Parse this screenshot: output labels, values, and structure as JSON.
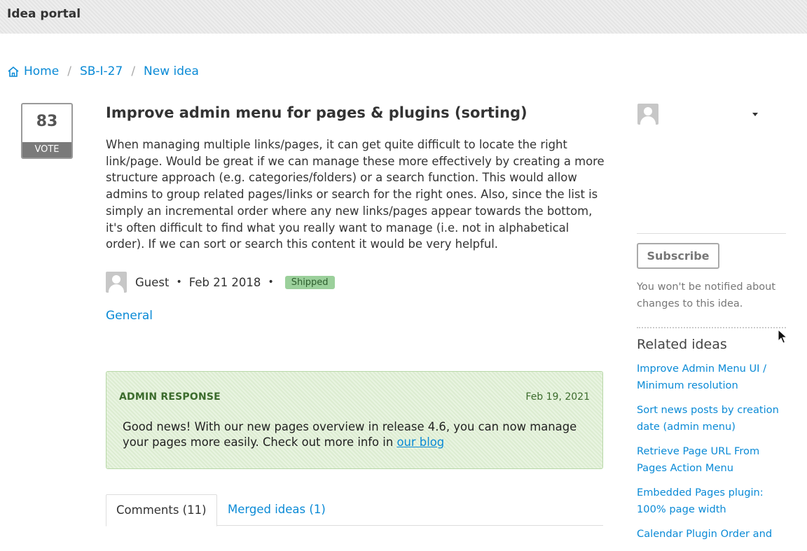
{
  "header": {
    "title": "Idea portal"
  },
  "breadcrumb": {
    "home": "Home",
    "id": "SB-I-27",
    "current": "New idea"
  },
  "idea": {
    "votes": "83",
    "vote_label": "VOTE",
    "title": "Improve admin menu for pages & plugins (sorting)",
    "description": "When managing multiple links/pages, it can get quite difficult to locate the right link/page. Would be great if we can manage these more effectively by creating a more structure approach (e.g. categories/folders) or a search function. This would allow admins to group related pages/links or search for the right ones. Also, since the list is simply an incremental order where any new links/pages appear towards the bottom, it's often difficult to find what you really want to manage (i.e. not in alphabetical order). If we can sort or search this content it would be very helpful.",
    "author": "Guest",
    "date": "Feb 21 2018",
    "status": "Shipped",
    "category": "General"
  },
  "admin_response": {
    "heading": "ADMIN RESPONSE",
    "date": "Feb 19, 2021",
    "text": "Good news! With our new pages overview in release 4.6, you can now manage your pages more easily. Check out more info in ",
    "link": "our blog"
  },
  "tabs": [
    {
      "label": "Comments (11)"
    },
    {
      "label": "Merged ideas (1)"
    }
  ],
  "sidebar": {
    "subscribe_label": "Subscribe",
    "subscribe_note": "You won't be notified about changes to this idea.",
    "related_title": "Related ideas",
    "related": [
      "Improve Admin Menu UI / Minimum resolution",
      "Sort news posts by creation date (admin menu)",
      "Retrieve Page URL From Pages Action Menu",
      "Embedded Pages plugin: 100% page width",
      "Calendar Plugin Order and"
    ]
  },
  "colors": {
    "link": "#0a8ad6",
    "status_badge": "#9bd09b",
    "admin_bg": "#dff0d4"
  },
  "icons": [
    "home-icon",
    "user-avatar-icon",
    "chevron-down-icon",
    "mouse-cursor-icon"
  ]
}
